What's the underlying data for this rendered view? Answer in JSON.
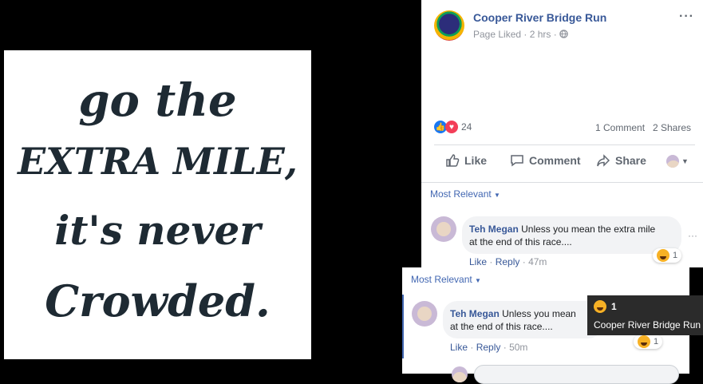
{
  "image": {
    "lines": [
      "go the",
      "EXTRA MILE,",
      "it's never",
      "Crowded."
    ]
  },
  "post": {
    "page_name": "Cooper River Bridge Run",
    "meta": "Page Liked · 2 hrs ·",
    "more": "···",
    "reaction_count": "24",
    "comments": "1 Comment",
    "shares": "2 Shares"
  },
  "actions": {
    "like": "Like",
    "comment": "Comment",
    "share": "Share"
  },
  "sort_label": "Most Relevant",
  "comment1": {
    "author": "Teh Megan",
    "text_line1": "Unless you mean the extra mile",
    "text_line2": "at the end of this race....",
    "like": "Like",
    "reply": "Reply",
    "time": "47m",
    "reaction_count": "1",
    "more": "···"
  },
  "comment2": {
    "author": "Teh Megan",
    "text_line1": "Unless you mean",
    "text_line2": "at the end of this race....",
    "like": "Like",
    "reply": "Reply",
    "time": "50m",
    "reaction_count": "1"
  },
  "tooltip": {
    "count": "1",
    "name": "Cooper River Bridge Run"
  },
  "colors": {
    "link": "#385898",
    "like": "#1877f2",
    "love": "#f33e58"
  }
}
